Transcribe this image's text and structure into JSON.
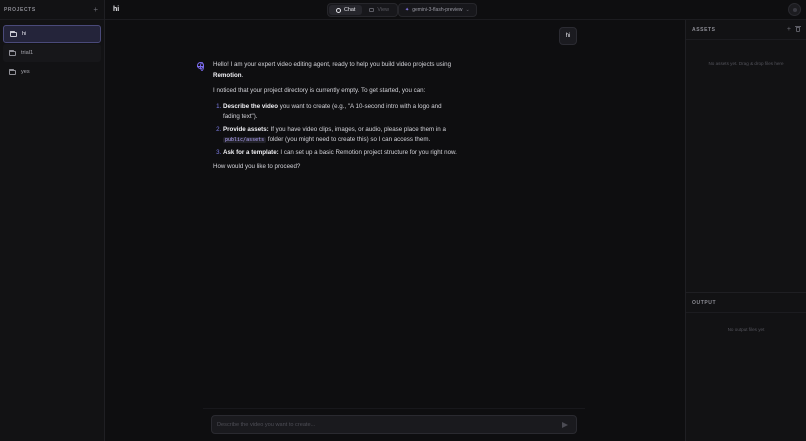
{
  "sidebar": {
    "title": "PROJECTS",
    "add": "+",
    "projects": [
      {
        "name": "hi"
      },
      {
        "name": "trial1"
      },
      {
        "name": "yes"
      }
    ]
  },
  "topbar": {
    "title": "hi",
    "tabs": [
      {
        "label": "Chat",
        "icon": "chat-icon"
      },
      {
        "label": "View",
        "icon": "view-icon"
      }
    ],
    "model": "gemini-3-flash-preview"
  },
  "chat": {
    "user_message": "hi",
    "assistant": {
      "intro_pre": "Hello! I am your expert video editing agent, ready to help you build video projects using ",
      "intro_bold": "Remotion",
      "intro_post": ".",
      "notice": "I noticed that your project directory is currently empty. To get started, you can:",
      "items": [
        {
          "bold": "Describe the video",
          "text": " you want to create (e.g., \"A 10-second intro with a logo and fading text\")."
        },
        {
          "bold": "Provide assets:",
          "text_pre": " If you have video clips, images, or audio, please place them in a ",
          "code": "public/assets",
          "text_post": " folder (you might need to create this) so I can access them."
        },
        {
          "bold": "Ask for a template:",
          "text": " I can set up a basic Remotion project structure for you right now."
        }
      ],
      "closing": "How would you like to proceed?"
    },
    "input_placeholder": "Describe the video you want to create..."
  },
  "assets": {
    "title": "ASSETS",
    "empty": "No assets yet. Drag & drop files here"
  },
  "output": {
    "title": "OUTPUT",
    "empty": "No output files yet"
  }
}
